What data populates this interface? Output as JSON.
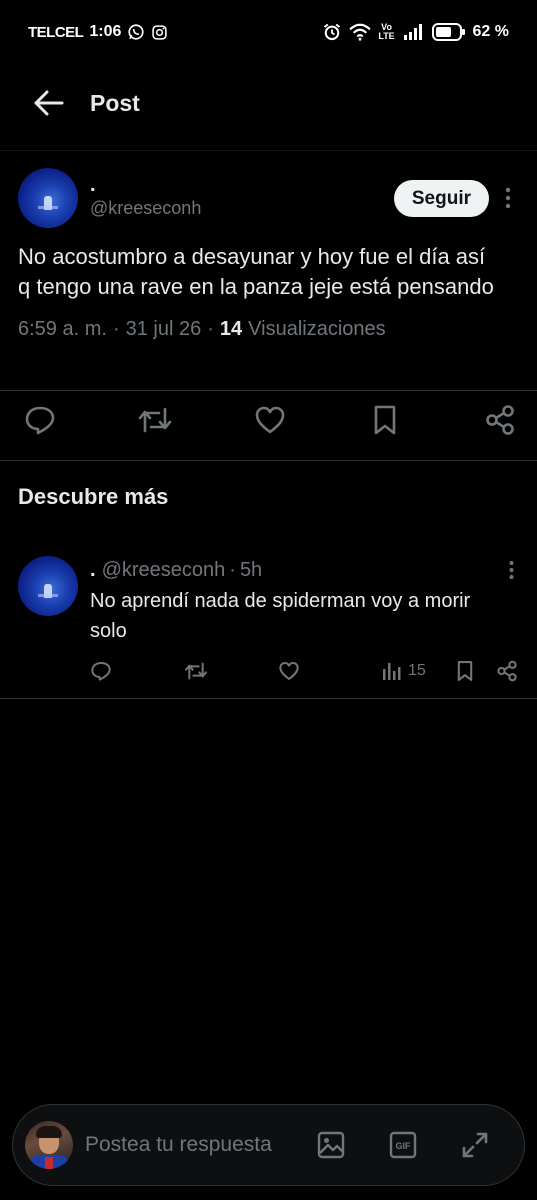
{
  "status_bar": {
    "carrier": "TELCEL",
    "time": "1:06",
    "battery": "62 %",
    "network": "Vo LTE"
  },
  "header": {
    "title": "Post"
  },
  "post": {
    "display_name": ".",
    "handle": "@kreeseconh",
    "follow_label": "Seguir",
    "text": "No acostumbro a desayunar y hoy fue el día así q tengo una rave en la panza jeje está pensando",
    "time": "6:59 a. m.",
    "date": "31 jul 26",
    "views_count": "14",
    "views_label": "Visualizaciones",
    "separator": "·"
  },
  "discover": {
    "title": "Descubre más",
    "items": [
      {
        "display_name": ".",
        "handle": "@kreeseconh",
        "time": "5h",
        "text": "No aprendí nada de spiderman voy a morir solo",
        "views": "15"
      }
    ]
  },
  "reply": {
    "placeholder": "Postea tu respuesta"
  },
  "colors": {
    "background": "#000000",
    "text_primary": "#e7e9ea",
    "text_secondary": "#71767b",
    "divider": "#2f3336",
    "follow_bg": "#eff3f4"
  }
}
